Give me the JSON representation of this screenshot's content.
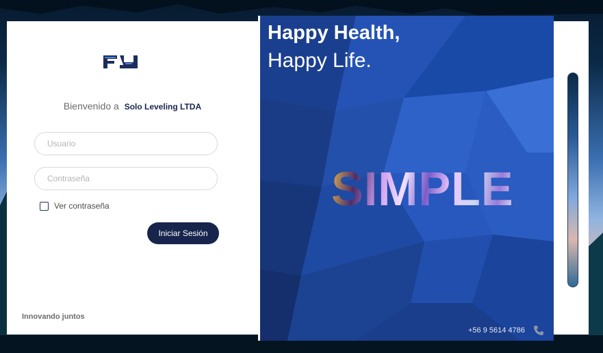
{
  "login": {
    "welcome_text": "Bienvenido a",
    "company_name": "Solo Leveling LTDA",
    "user_placeholder": "Usuario",
    "password_placeholder": "Contraseña",
    "show_password_label": "Ver contraseña",
    "submit_label": "Iniciar Sesión",
    "footer_tagline": "Innovando juntos"
  },
  "hero": {
    "headline_bold": "Happy Health,",
    "headline_light": "Happy Life.",
    "feature_word": "SIMPLE",
    "phone": "+56 9 5614 4786",
    "phone_icon": "phone-icon"
  },
  "colors": {
    "brand_navy": "#17254d",
    "hero_blue": "#1d4a9e"
  }
}
